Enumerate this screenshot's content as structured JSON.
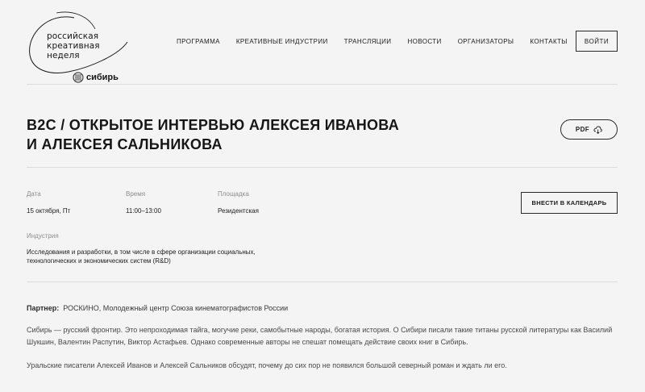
{
  "logo": {
    "lines": [
      "российская",
      "креативная",
      "неделя"
    ],
    "region": "сибирь"
  },
  "nav": {
    "items": [
      {
        "label": "ПРОГРАММА"
      },
      {
        "label": "КРЕАТИВНЫЕ ИНДУСТРИИ"
      },
      {
        "label": "ТРАНСЛЯЦИИ"
      },
      {
        "label": "НОВОСТИ"
      },
      {
        "label": "ОРГАНИЗАТОРЫ"
      },
      {
        "label": "КОНТАКТЫ"
      }
    ],
    "login_label": "ВОЙТИ"
  },
  "event": {
    "title": "B2C / Открытое интервью Алексея Иванова и Алексея Сальникова",
    "pdf_label": "PDF",
    "date_label": "Дата",
    "date_value": "15 октября, Пт",
    "time_label": "Время",
    "time_value": "11:00–13:00",
    "venue_label": "Площадка",
    "venue_value": "Резидентская",
    "calendar_label": "ВНЕСТИ В КАЛЕНДАРЬ",
    "industry_label": "Индустрия",
    "industry_value": "Исследования и разработки, в том числе в сфере организации социальных, технологических и экономических систем (R&D)"
  },
  "description": {
    "partner_label": "Партнер:",
    "partner_value": "РОСКИНО, Молодежный центр Союза кинематографистов России",
    "paragraphs": [
      "Сибирь — русский фронтир. Это непроходимая тайга, могучие реки, самобытные народы, богатая история. О Сибири писали такие титаны русской литературы как Василий Шукшин, Валентин Распутин, Виктор Астафьев. Однако современные авторы не спешат помещать действие своих книг в Сибирь.",
      "Уральские писатели Алексей Иванов и Алексей Сальников обсудят, почему до сих пор не появился большой северный роман и ждать ли его."
    ]
  },
  "colors": {
    "background": "#f4f4f4",
    "text": "#1c1c1c",
    "muted": "#8d8d8d",
    "divider": "#dcdcdc"
  },
  "icons": [
    "download-cloud-icon",
    "logo-ring",
    "sibir-emblem-icon"
  ]
}
